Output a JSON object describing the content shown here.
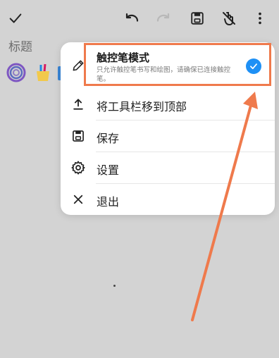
{
  "canvas": {
    "title": "标题"
  },
  "toolbar": {
    "confirm_icon": "check-icon",
    "undo_icon": "undo-icon",
    "redo_icon": "redo-icon",
    "save_icon": "save-icon",
    "stylus_icon": "touch-pen-icon",
    "more_icon": "more-vert-icon"
  },
  "menu": {
    "stylus_mode": {
      "title": "触控笔模式",
      "description": "只允许触控笔书写和绘图，请确保已连接触控笔。",
      "checked": true,
      "icon": "pen-icon"
    },
    "items": [
      {
        "label": "将工具栏移到顶部",
        "icon": "upload-icon"
      },
      {
        "label": "保存",
        "icon": "save-icon"
      },
      {
        "label": "设置",
        "icon": "gear-icon"
      },
      {
        "label": "退出",
        "icon": "close-icon"
      }
    ]
  },
  "colors": {
    "background": "#d3d3d3",
    "menu": "#ffffff",
    "accent": "#1e90f5",
    "annotation": "#ef7a4c"
  }
}
